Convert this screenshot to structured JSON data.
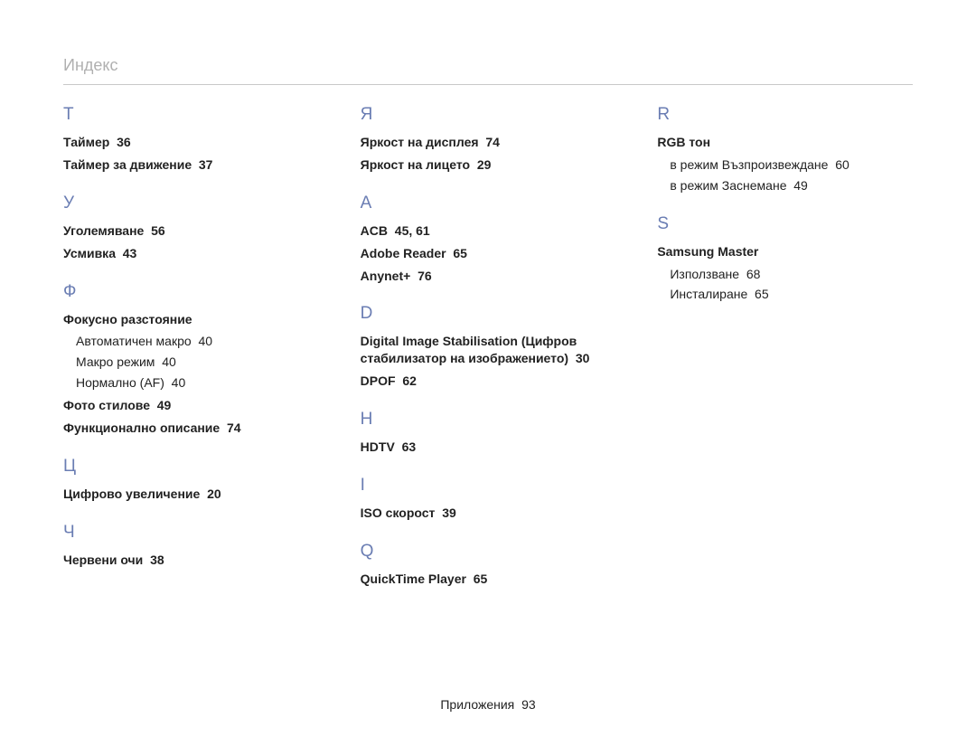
{
  "page_title": "Индекс",
  "footer": {
    "label": "Приложения",
    "page": "93"
  },
  "columns": [
    {
      "sections": [
        {
          "letter": "Т",
          "entries": [
            {
              "term": "Таймер",
              "page": "36"
            },
            {
              "term": "Таймер за движение",
              "page": "37"
            }
          ]
        },
        {
          "letter": "У",
          "entries": [
            {
              "term": "Уголемяване",
              "page": "56"
            },
            {
              "term": "Усмивка",
              "page": "43"
            }
          ]
        },
        {
          "letter": "Ф",
          "entries": [
            {
              "term": "Фокусно разстояние",
              "subs": [
                {
                  "term": "Автоматичен макро",
                  "page": "40"
                },
                {
                  "term": "Макро режим",
                  "page": "40"
                },
                {
                  "term": "Нормално (AF)",
                  "page": "40"
                }
              ]
            },
            {
              "term": "Фото стилове",
              "page": "49"
            },
            {
              "term": "Функционално описание",
              "page": "74"
            }
          ]
        },
        {
          "letter": "Ц",
          "entries": [
            {
              "term": "Цифрово увеличение",
              "page": "20"
            }
          ]
        },
        {
          "letter": "Ч",
          "entries": [
            {
              "term": "Червени очи",
              "page": "38"
            }
          ]
        }
      ]
    },
    {
      "sections": [
        {
          "letter": "Я",
          "entries": [
            {
              "term": "Яркост на дисплея",
              "page": "74"
            },
            {
              "term": "Яркост на лицето",
              "page": "29"
            }
          ]
        },
        {
          "letter": "A",
          "entries": [
            {
              "term": "ACB",
              "page": "45, 61"
            },
            {
              "term": "Adobe Reader",
              "page": "65"
            },
            {
              "term": "Anynet+",
              "page": "76"
            }
          ]
        },
        {
          "letter": "D",
          "entries": [
            {
              "term": "Digital Image Stabilisation (Цифров стабилизатор на изображението)",
              "page": "30"
            },
            {
              "term": "DPOF",
              "page": "62"
            }
          ]
        },
        {
          "letter": "H",
          "entries": [
            {
              "term": "HDTV",
              "page": "63"
            }
          ]
        },
        {
          "letter": "I",
          "entries": [
            {
              "term": "ISO скорост",
              "page": "39"
            }
          ]
        },
        {
          "letter": "Q",
          "entries": [
            {
              "term": "QuickTime Player",
              "page": "65"
            }
          ]
        }
      ]
    },
    {
      "sections": [
        {
          "letter": "R",
          "entries": [
            {
              "term": "RGB тон",
              "subs": [
                {
                  "term": "в режим Възпроизвеждане",
                  "page": "60"
                },
                {
                  "term": "в режим Заснемане",
                  "page": "49"
                }
              ]
            }
          ]
        },
        {
          "letter": "S",
          "entries": [
            {
              "term": "Samsung Master",
              "subs": [
                {
                  "term": "Използване",
                  "page": "68"
                },
                {
                  "term": "Инсталиране",
                  "page": "65"
                }
              ]
            }
          ]
        }
      ]
    }
  ]
}
